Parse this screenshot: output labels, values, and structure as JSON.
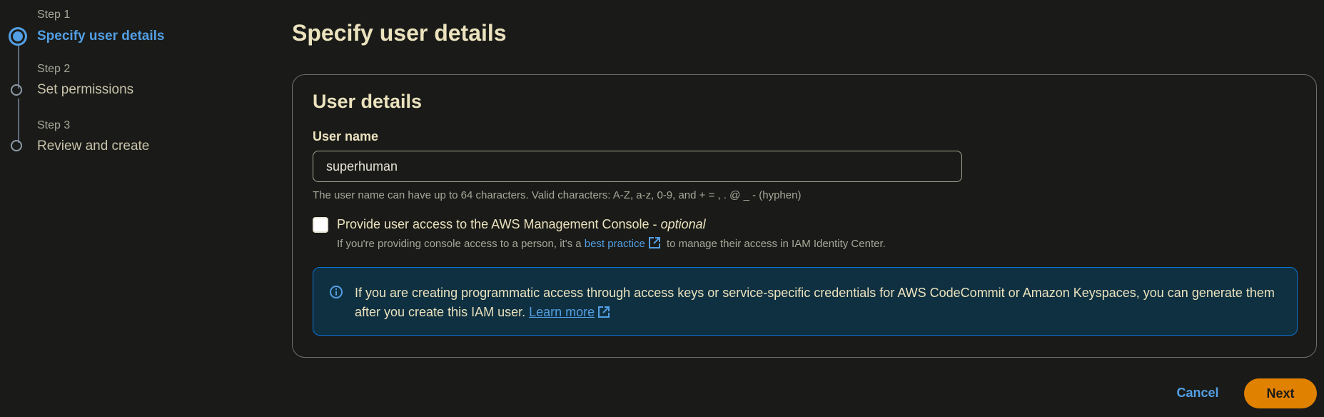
{
  "wizard": {
    "steps": [
      {
        "number": "Step 1",
        "title": "Specify user details",
        "status": "active"
      },
      {
        "number": "Step 2",
        "title": "Set permissions",
        "status": "pending"
      },
      {
        "number": "Step 3",
        "title": "Review and create",
        "status": "pending"
      }
    ]
  },
  "main": {
    "title": "Specify user details",
    "card": {
      "title": "User details",
      "username": {
        "label": "User name",
        "value": "superhuman",
        "hint": "The user name can have up to 64 characters. Valid characters: A-Z, a-z, 0-9, and + = , . @ _ - (hyphen)"
      },
      "console_access": {
        "label": "Provide user access to the AWS Management Console - ",
        "optional": "optional",
        "checked": false,
        "hint_prefix": "If you're providing console access to a person, it's a ",
        "hint_link": "best practice",
        "hint_suffix": " to manage their access in IAM Identity Center."
      },
      "info": {
        "text": "If you are creating programmatic access through access keys or service-specific credentials for AWS CodeCommit or Amazon Keyspaces, you can generate them after you create this IAM user. ",
        "link": "Learn more"
      }
    }
  },
  "footer": {
    "cancel_label": "Cancel",
    "next_label": "Next"
  },
  "colors": {
    "background": "#1a1b18",
    "accent_blue": "#539fe5",
    "primary_orange": "#e08100",
    "info_bg": "#0f3040"
  }
}
